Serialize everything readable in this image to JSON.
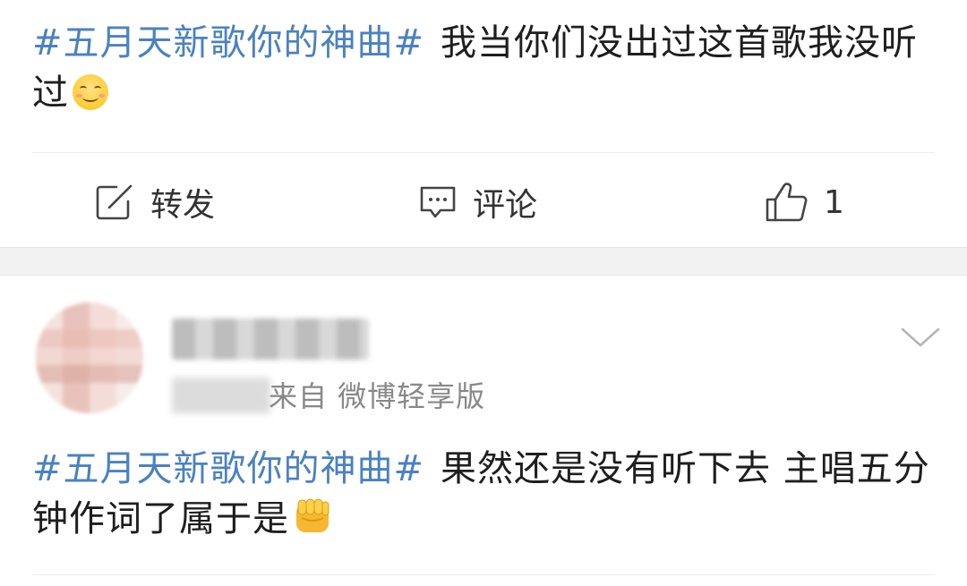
{
  "post1": {
    "hashtag": "#五月天新歌你的神曲#",
    "text": "我当你们没出过这首歌我没听过",
    "emoji": "smile-emoji"
  },
  "actions": {
    "repost_label": "转发",
    "comment_label": "评论",
    "like_count": "1",
    "repost_icon": "edit-box-icon",
    "comment_icon": "comment-bubble-icon",
    "like_icon": "thumbs-up-icon"
  },
  "post2": {
    "source": "来自 微博轻享版",
    "hashtag": "#五月天新歌你的神曲#",
    "text": "果然还是没有听下去 主唱五分钟作词了属于是",
    "emoji": "fist-emoji",
    "menu_icon": "chevron-down-icon"
  },
  "colors": {
    "hashtag": "#4a82c0",
    "text": "#1e1e1e",
    "secondary": "#888888",
    "separator": "#f2f2f2"
  }
}
